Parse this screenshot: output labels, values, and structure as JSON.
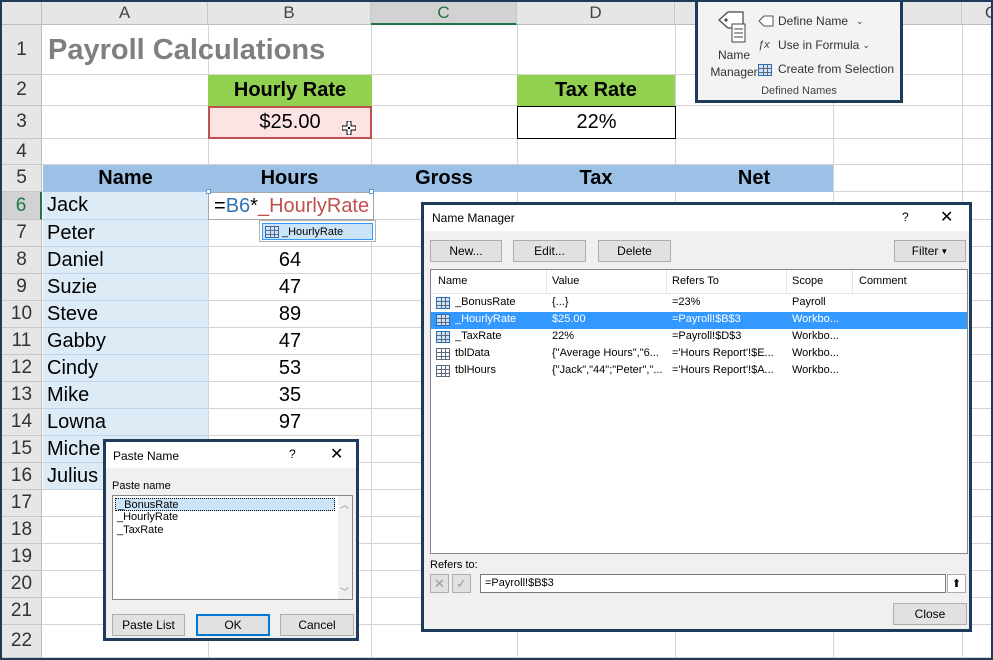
{
  "columns": [
    "A",
    "B",
    "C",
    "D",
    "",
    "",
    "G"
  ],
  "rows": [
    "1",
    "2",
    "3",
    "4",
    "5",
    "6",
    "7",
    "8",
    "9",
    "10",
    "11",
    "12",
    "13",
    "14",
    "15",
    "16",
    "17",
    "18",
    "19",
    "20",
    "21",
    "22"
  ],
  "sheet": {
    "title": "Payroll Calculations",
    "hourly_rate_label": "Hourly Rate",
    "hourly_rate_value": "$25.00",
    "tax_rate_label": "Tax Rate",
    "tax_rate_value": "22%",
    "headers": [
      "Name",
      "Hours",
      "Gross",
      "Tax",
      "Net"
    ],
    "names": [
      "Jack",
      "Peter",
      "Daniel",
      "Suzie",
      "Steve",
      "Gabby",
      "Cindy",
      "Mike",
      "Lowna",
      "Miche",
      "Julius"
    ],
    "hours": [
      "",
      "",
      "64",
      "47",
      "89",
      "47",
      "53",
      "35",
      "97"
    ],
    "formula_ref": "B6",
    "formula_name": "_HourlyRate",
    "autocomplete": "_HourlyRate"
  },
  "ribbon": {
    "name_manager": [
      "Name",
      "Manager"
    ],
    "define_name": "Define Name",
    "use_in_formula": "Use in Formula",
    "create_from_selection": "Create from Selection",
    "group_label": "Defined Names"
  },
  "name_manager": {
    "title": "Name Manager",
    "help": "?",
    "buttons": {
      "new": "New...",
      "edit": "Edit...",
      "delete": "Delete",
      "filter": "Filter",
      "close": "Close"
    },
    "columns": [
      "Name",
      "Value",
      "Refers To",
      "Scope",
      "Comment"
    ],
    "rows": [
      {
        "name": "_BonusRate",
        "value": "{...}",
        "refers": "=23%",
        "scope": "Payroll",
        "comment": ""
      },
      {
        "name": "_HourlyRate",
        "value": "$25.00",
        "refers": "=Payroll!$B$3",
        "scope": "Workbo...",
        "comment": ""
      },
      {
        "name": "_TaxRate",
        "value": "22%",
        "refers": "=Payroll!$D$3",
        "scope": "Workbo...",
        "comment": ""
      },
      {
        "name": "tblData",
        "value": "{\"Average Hours\",\"6...",
        "refers": "='Hours Report'!$E...",
        "scope": "Workbo...",
        "comment": ""
      },
      {
        "name": "tblHours",
        "value": "{\"Jack\",\"44\";\"Peter\",\"...",
        "refers": "='Hours Report'!$A...",
        "scope": "Workbo...",
        "comment": ""
      }
    ],
    "refers_to_label": "Refers to:",
    "refers_to_value": "=Payroll!$B$3"
  },
  "paste_name": {
    "title": "Paste Name",
    "help": "?",
    "list_label": "Paste name",
    "items": [
      "_BonusRate",
      "_HourlyRate",
      "_TaxRate"
    ],
    "buttons": {
      "paste_list": "Paste List",
      "ok": "OK",
      "cancel": "Cancel"
    }
  }
}
